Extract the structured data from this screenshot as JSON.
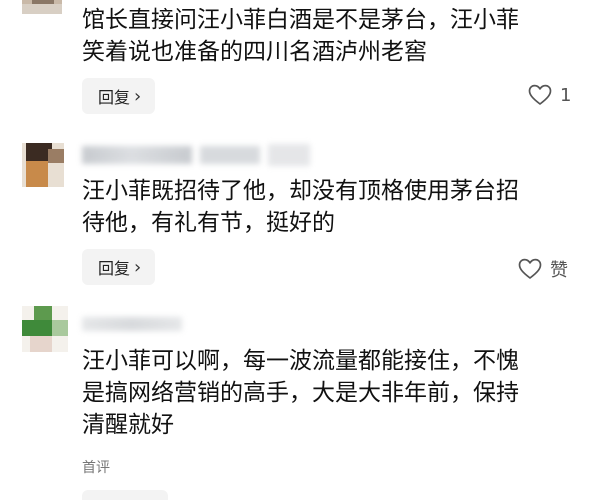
{
  "comments": [
    {
      "text_lines": [
        "馆长直接问汪小菲白酒是不是茅台，汪小菲",
        "笑着说也准备的四川名酒泸州老窖"
      ],
      "reply_label": "回复",
      "like_text": "1"
    },
    {
      "username": "",
      "text_lines": [
        "汪小菲既招待了他，却没有顶格使用茅台招",
        "待他，有礼有节，挺好的"
      ],
      "reply_label": "回复",
      "like_text": "赞"
    },
    {
      "username": "",
      "text_lines": [
        "汪小菲可以啊，每一波流量都能接住，不愧",
        "是搞网络营销的高手，大是大非年前，保持",
        "清醒就好"
      ],
      "tag": "首评"
    }
  ],
  "icons": {
    "like": "heart-outline-icon",
    "reply_chevron": "chevron-right-icon"
  },
  "colors": {
    "background": "#ffffff",
    "text": "#111111",
    "reply_bg": "#f3f3f3",
    "muted": "#777777"
  }
}
